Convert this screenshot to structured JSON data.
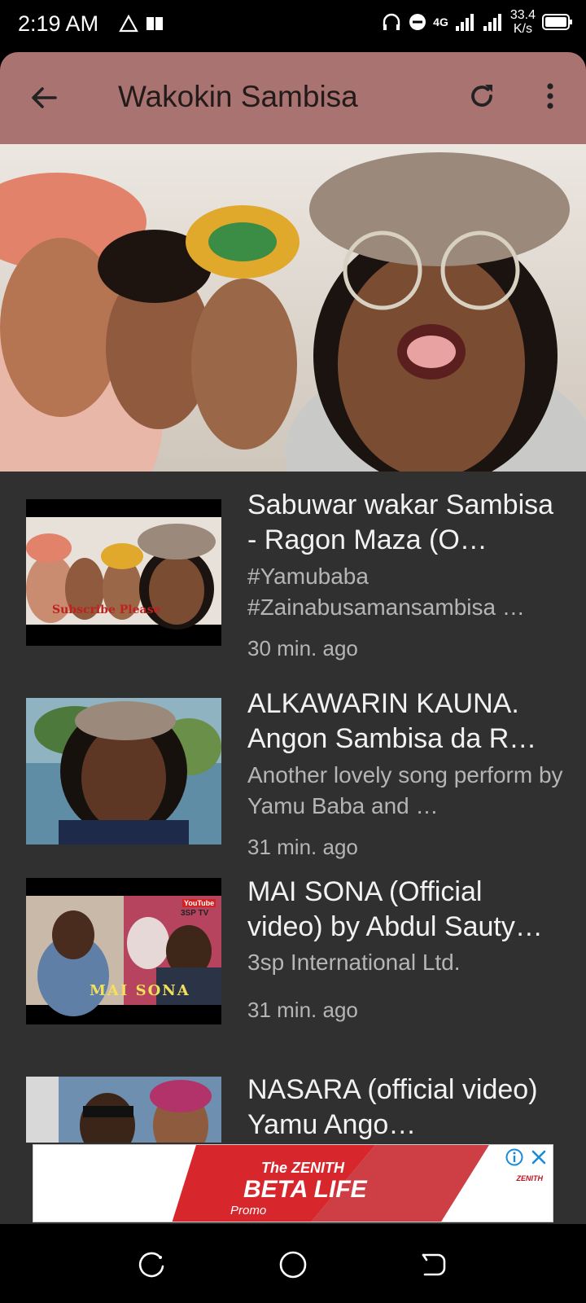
{
  "status_bar": {
    "time": "2:19 AM",
    "network": "4G",
    "speed_value": "33.4",
    "speed_unit": "K/s"
  },
  "app_bar": {
    "title": "Wakokin Sambisa",
    "icons": [
      "back-arrow-icon",
      "refresh-icon",
      "more-vert-icon"
    ]
  },
  "videos": [
    {
      "title": "Sabuwar wakar Sam­bisa - Ragon Maza (O…",
      "description": "#Yamubaba #Zainabusamansambisa …",
      "time": "30 min. ago",
      "thumb_caption": "Subscribe Please"
    },
    {
      "title": "ALKAWARIN KAUNA. Angon Sambisa da R…",
      "description": "Another lovely song  per­form by Yamu Baba and …",
      "time": "31 min. ago"
    },
    {
      "title": "MAI SONA (Official video) by Abdul Sauty…",
      "description": "3sp International Ltd.",
      "time": "31 min. ago",
      "thumb_caption": "MAI SONA",
      "thumb_badge_top": "YouTube",
      "thumb_badge_bottom": "3SP TV"
    },
    {
      "title": "NASARA (official video) Yamu Ango…",
      "description": "",
      "time": ""
    }
  ],
  "ad": {
    "line1": "The ZENITH",
    "line2": "BETA LIFE",
    "line3": "Promo",
    "brand": "ZENITH"
  },
  "colors": {
    "app_bar": "#a87370",
    "feed_bg": "#303030",
    "ad_red": "#d7262c"
  }
}
